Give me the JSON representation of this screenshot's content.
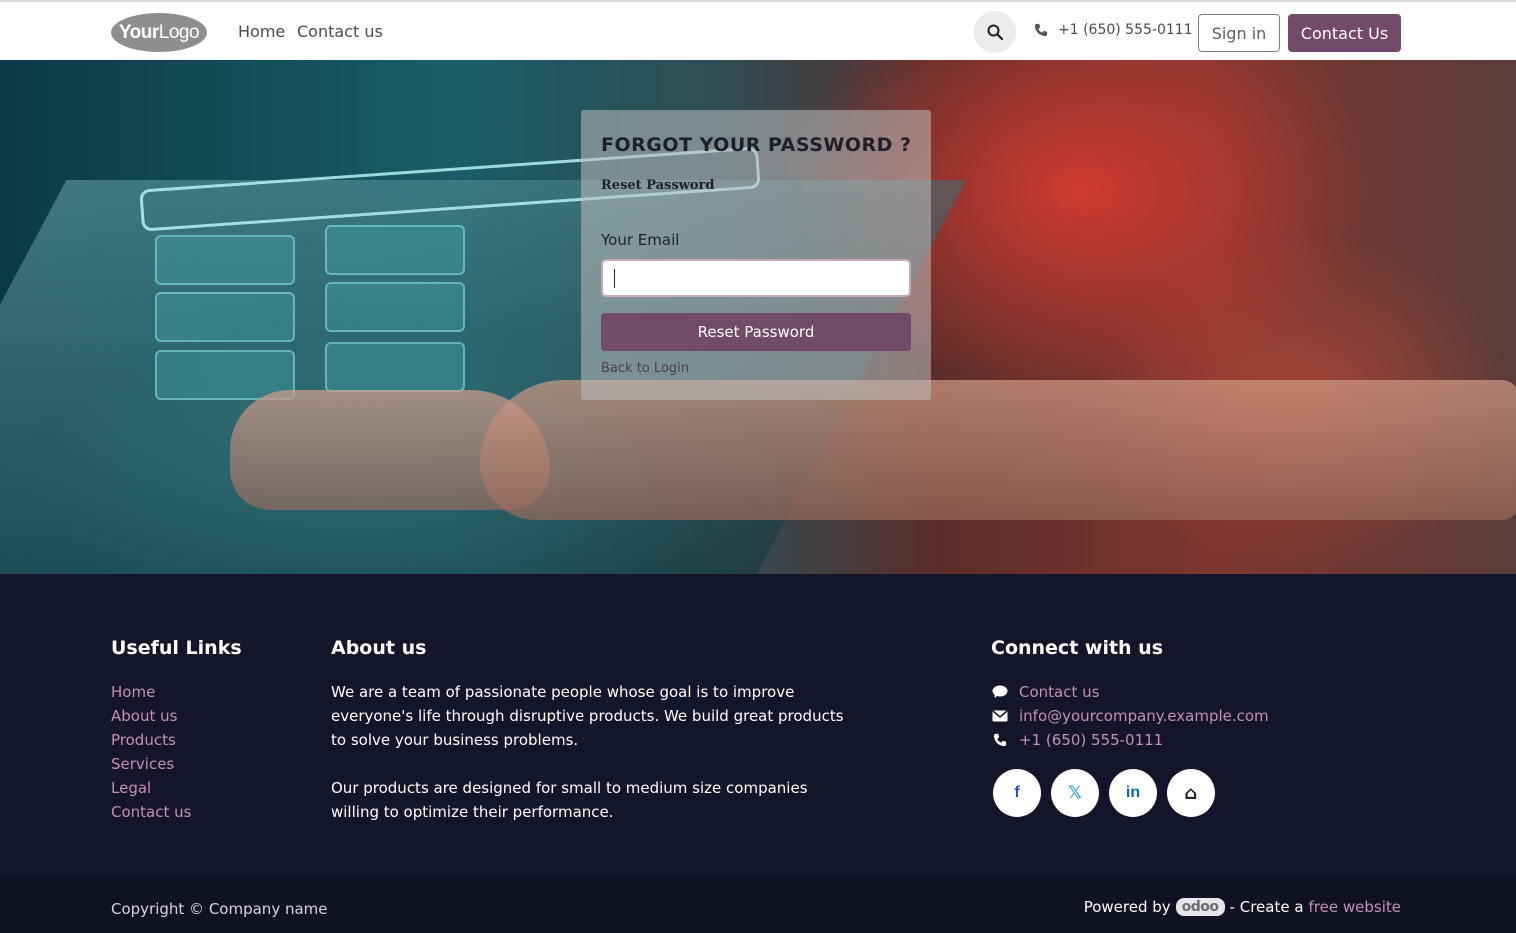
{
  "header": {
    "logo": {
      "bold": "Your",
      "thin": "Logo"
    },
    "nav": [
      "Home",
      "Contact us"
    ],
    "phone": "+1 (650) 555-0111",
    "signin_label": "Sign in",
    "contact_label": "Contact Us"
  },
  "form": {
    "title": "FORGOT YOUR PASSWORD ?",
    "subtitle": "Reset Password",
    "email_label": "Your Email",
    "email_value": "",
    "submit_label": "Reset Password",
    "back_link": "Back to Login"
  },
  "footer": {
    "useful_links_title": "Useful Links",
    "useful_links": [
      "Home",
      "About us",
      "Products",
      "Services",
      "Legal",
      "Contact us"
    ],
    "about_title": "About us",
    "about_p1": "We are a team of passionate people whose goal is to improve everyone's life through disruptive products. We build great products to solve your business problems.",
    "about_p2": "Our products are designed for small to medium size companies willing to optimize their performance.",
    "connect_title": "Connect with us",
    "connect_items": [
      {
        "icon": "comment-icon",
        "text": "Contact us"
      },
      {
        "icon": "envelope-icon",
        "text": "info@yourcompany.example.com"
      },
      {
        "icon": "phone-icon",
        "text": "+1 (650) 555-0111"
      }
    ],
    "socials": [
      {
        "icon": "facebook-icon",
        "glyph": "f"
      },
      {
        "icon": "x-icon",
        "glyph": "𝕏"
      },
      {
        "icon": "linkedin-icon",
        "glyph": "in"
      },
      {
        "icon": "home-icon",
        "glyph": "⌂"
      }
    ]
  },
  "bottom": {
    "copyright": "Copyright © Company name",
    "powered_by": "Powered by",
    "odoo": "odoo",
    "create_text": "- Create a",
    "free_website": "free website"
  },
  "colors": {
    "accent": "#714b67",
    "footer_bg": "#14152a",
    "link": "#c58fb7"
  }
}
